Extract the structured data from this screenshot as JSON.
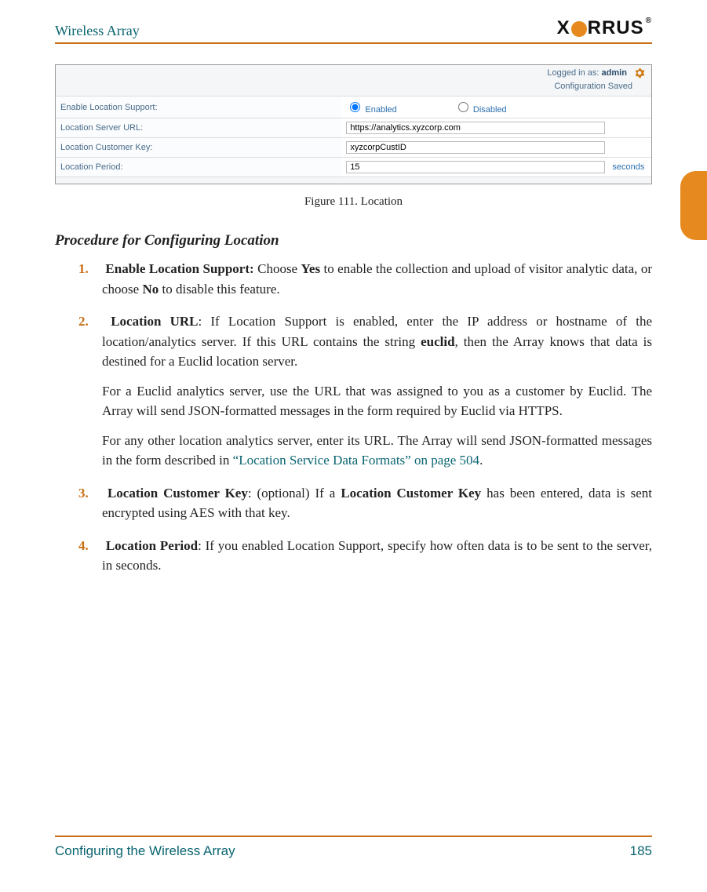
{
  "header": {
    "title": "Wireless Array",
    "brand_left": "X",
    "brand_mid": "RRUS",
    "brand_reg": "®"
  },
  "thumb": {
    "label": ""
  },
  "figure": {
    "caption": "Figure 111. Location",
    "status": {
      "logged_in_prefix": "Logged in as: ",
      "user": "admin",
      "config_saved": "Configuration Saved"
    },
    "rows": {
      "enable_label": "Enable Location Support:",
      "enabled": "Enabled",
      "disabled": "Disabled",
      "url_label": "Location Server URL:",
      "url_value": "https://analytics.xyzcorp.com",
      "key_label": "Location Customer Key:",
      "key_value": "xyzcorpCustID",
      "period_label": "Location Period:",
      "period_value": "15",
      "period_unit": "seconds"
    }
  },
  "body": {
    "section_title": "Procedure for Configuring Location",
    "step1_a": "Enable Location Support:",
    "step1_b": " Choose ",
    "step1_c": "Yes",
    "step1_d": " to enable the collection and upload of visitor analytic data, or choose ",
    "step1_e": "No",
    "step1_f": " to disable this feature.",
    "step2_a": "Location URL",
    "step2_b": ": If Location Support is enabled, enter the IP address or hostname of the location/analytics server. If this URL contains the string ",
    "step2_c": "euclid",
    "step2_d": ", then the Array knows that data is destined for a Euclid location server.",
    "step2_p2": "For a Euclid analytics server, use the URL that was assigned to you as a customer by Euclid. The Array will send JSON-formatted messages in the form required by Euclid via HTTPS.",
    "step2_p3a": "For any other location analytics server, enter its URL. The Array will send JSON-formatted messages in the form described in ",
    "step2_p3b": "“Location Service Data Formats” on page 504",
    "step2_p3c": ".",
    "step3_a": "Location Customer Key",
    "step3_b": ": (optional) If a ",
    "step3_c": "Location Customer Key",
    "step3_d": " has been entered, data is sent encrypted using AES with that key.",
    "step4_a": "Location Period",
    "step4_b": ": If you enabled Location Support, specify how often data is to be sent to the server, in seconds."
  },
  "footer": {
    "left": "Configuring the Wireless Array",
    "right": "185"
  }
}
